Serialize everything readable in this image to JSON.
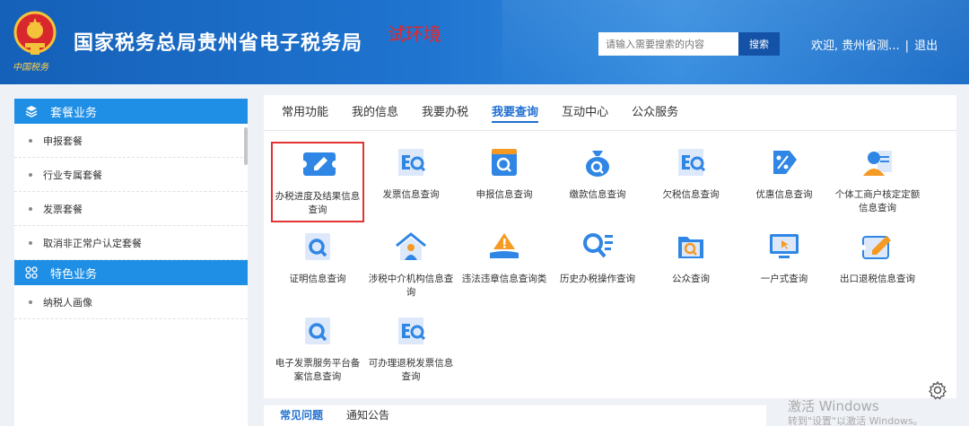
{
  "header": {
    "site_title": "国家税务总局贵州省电子税务局",
    "env_tag": "试环境",
    "emblem_caption": "中国税务",
    "search_placeholder": "请输入需要搜索的内容",
    "search_button": "搜索",
    "welcome": "欢迎, 贵州省测...",
    "separator": "|",
    "logout": "退出"
  },
  "sidebar": {
    "section1": {
      "title": "套餐业务",
      "icon": "layers-icon"
    },
    "section1_items": [
      "申报套餐",
      "行业专属套餐",
      "发票套餐",
      "取消非正常户认定套餐"
    ],
    "section2": {
      "title": "特色业务",
      "icon": "grid-icon"
    },
    "section2_items": [
      "纳税人画像"
    ]
  },
  "main": {
    "tabs": [
      "常用功能",
      "我的信息",
      "我要办税",
      "我要查询",
      "互动中心",
      "公众服务"
    ],
    "active_tab": "我要查询",
    "items": [
      {
        "label": "办税进度及结果信息查询",
        "icon": "pencil-ticket-icon",
        "selected": true
      },
      {
        "label": "发票信息查询",
        "icon": "invoice-search-icon"
      },
      {
        "label": "申报信息查询",
        "icon": "window-search-icon"
      },
      {
        "label": "缴款信息查询",
        "icon": "money-bag-search-icon"
      },
      {
        "label": "欠税信息查询",
        "icon": "invoice-search-icon"
      },
      {
        "label": "优惠信息查询",
        "icon": "discount-tag-icon"
      },
      {
        "label": "个体工商户核定定额信息查询",
        "icon": "person-document-icon"
      },
      {
        "label": "证明信息查询",
        "icon": "certificate-search-icon"
      },
      {
        "label": "涉税中介机构信息查询",
        "icon": "house-person-icon"
      },
      {
        "label": "违法违章信息查询类",
        "icon": "warning-hand-icon"
      },
      {
        "label": "历史办税操作查询",
        "icon": "search-list-icon"
      },
      {
        "label": "公众查询",
        "icon": "folder-search-icon"
      },
      {
        "label": "一户式查询",
        "icon": "monitor-cursor-icon"
      },
      {
        "label": "出口退税信息查询",
        "icon": "pencil-ticket-icon"
      },
      {
        "label": "电子发票服务平台备案信息查询",
        "icon": "certificate-search-icon"
      },
      {
        "label": "可办理退税发票信息查询",
        "icon": "invoice-search-icon"
      }
    ]
  },
  "bottom": {
    "tabs": [
      "常见问题",
      "通知公告"
    ]
  },
  "windows_watermark": {
    "line1": "激活 Windows",
    "line2": "转到\"设置\"以激活 Windows。"
  },
  "colors": {
    "header_blue": "#1f75d0",
    "accent_blue": "#1f8fe6",
    "active_tab": "#1f6fd0",
    "selected_border": "#e23232",
    "icon_blue": "#2f86e4",
    "icon_orange": "#f59a23"
  }
}
